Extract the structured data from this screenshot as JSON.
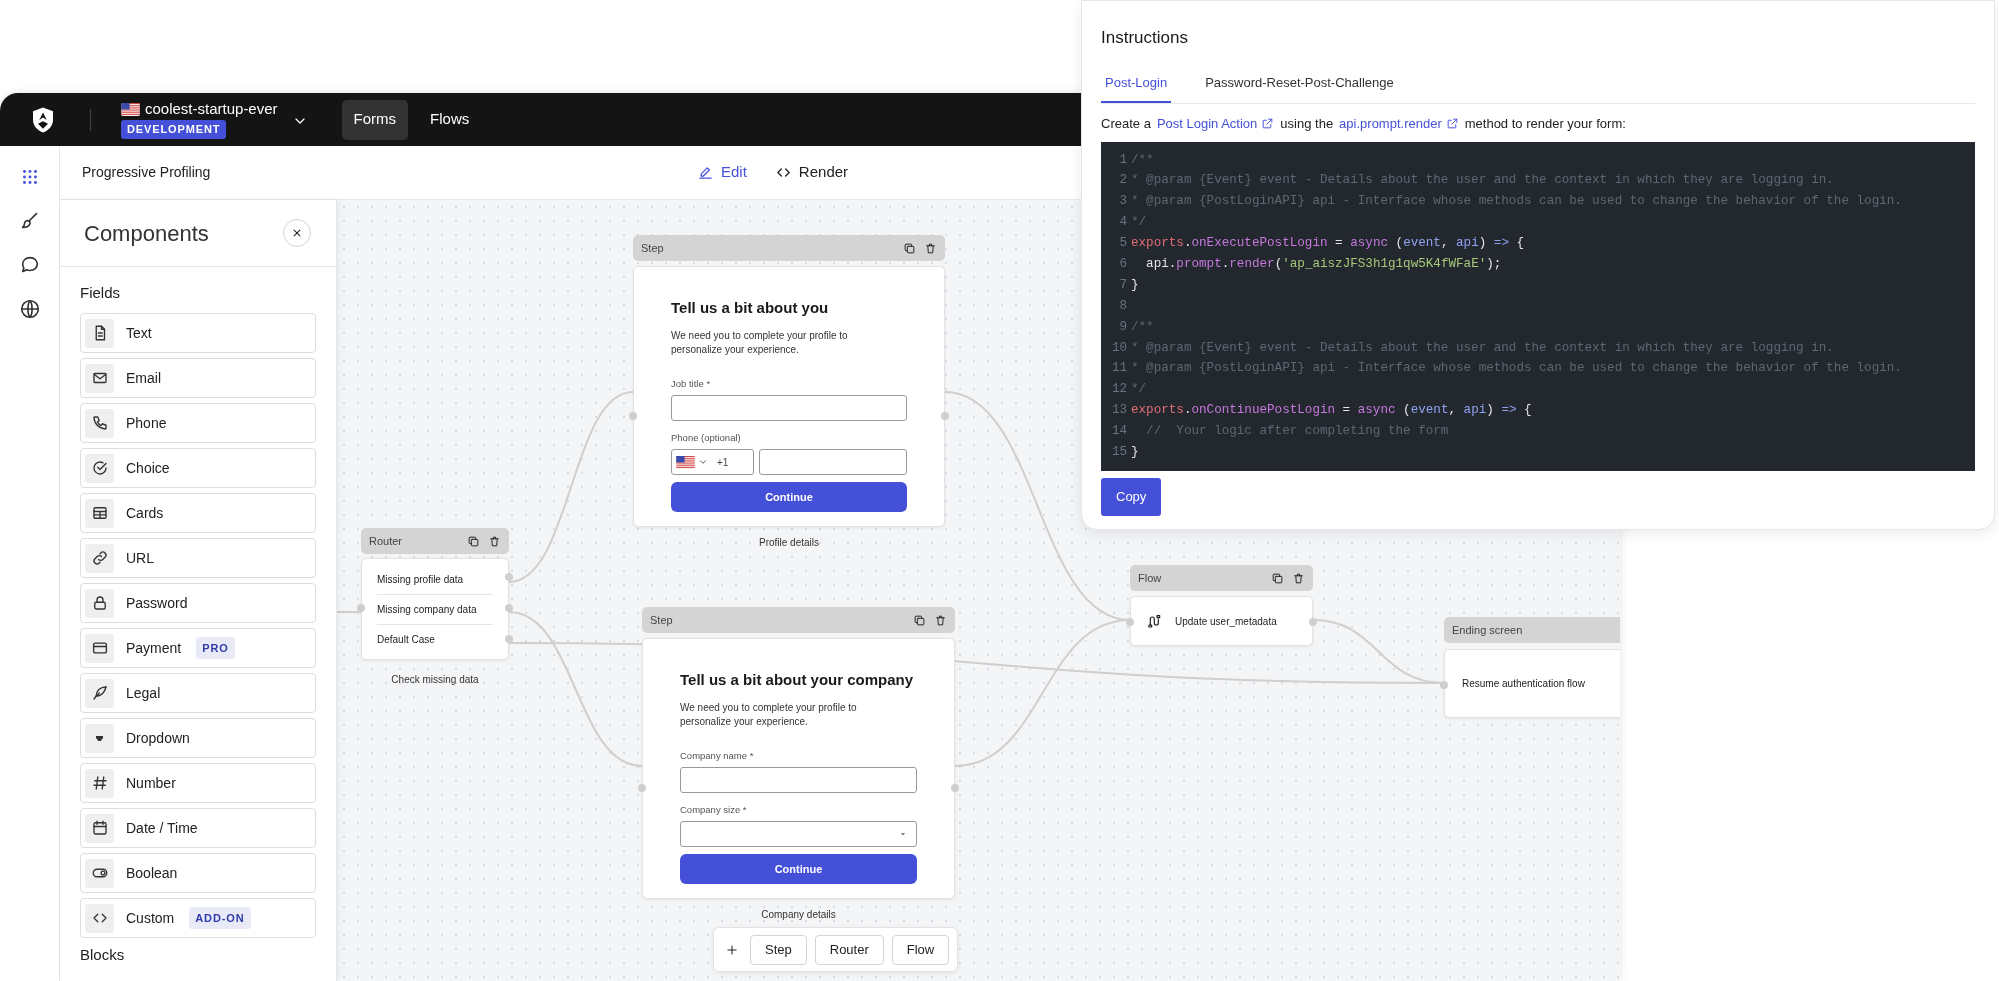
{
  "header": {
    "org": "coolest-startup-ever",
    "environment": "DEVELOPMENT",
    "nav": [
      {
        "label": "Forms",
        "selected": true
      },
      {
        "label": "Flows",
        "selected": false
      }
    ]
  },
  "rail": [
    {
      "kind": "grid",
      "selected": true
    },
    {
      "kind": "brush",
      "selected": false
    },
    {
      "kind": "chat",
      "selected": false
    },
    {
      "kind": "globe",
      "selected": false
    }
  ],
  "toolbar": {
    "title": "Progressive Profiling",
    "modes": [
      {
        "kind": "edit",
        "label": "Edit",
        "selected": true
      },
      {
        "kind": "render",
        "label": "Render",
        "selected": false
      }
    ]
  },
  "components": {
    "title": "Components",
    "sections": [
      {
        "heading": "Fields",
        "items": [
          {
            "kind": "text",
            "label": "Text"
          },
          {
            "kind": "email",
            "label": "Email"
          },
          {
            "kind": "phone",
            "label": "Phone"
          },
          {
            "kind": "choice",
            "label": "Choice"
          },
          {
            "kind": "cards",
            "label": "Cards"
          },
          {
            "kind": "url",
            "label": "URL"
          },
          {
            "kind": "password",
            "label": "Password"
          },
          {
            "kind": "payment",
            "label": "Payment",
            "badge": "PRO"
          },
          {
            "kind": "legal",
            "label": "Legal"
          },
          {
            "kind": "dropdown",
            "label": "Dropdown"
          },
          {
            "kind": "number",
            "label": "Number"
          },
          {
            "kind": "date",
            "label": "Date / Time"
          },
          {
            "kind": "boolean",
            "label": "Boolean"
          },
          {
            "kind": "custom",
            "label": "Custom",
            "badge": "ADD-ON"
          }
        ]
      },
      {
        "heading": "Blocks"
      }
    ]
  },
  "canvas": {
    "nodes": [
      {
        "kind": "step",
        "header": "Step",
        "title": "Tell us a bit about you",
        "description": "We need you to complete your profile to personalize your experience.",
        "fields": [
          {
            "kind": "text",
            "label": "Job title *"
          },
          {
            "kind": "phone",
            "label": "Phone (optional)",
            "code": "+1"
          }
        ],
        "button": "Continue",
        "caption": "Profile details"
      },
      {
        "kind": "router",
        "header": "Router",
        "routes": [
          "Missing profile data",
          "Missing company data",
          "Default Case"
        ],
        "caption": "Check missing data"
      },
      {
        "kind": "step",
        "header": "Step",
        "title": "Tell us a bit about your company",
        "description": "We need you to complete your profile to personalize your experience.",
        "fields": [
          {
            "kind": "text",
            "label": "Company name *"
          },
          {
            "kind": "select",
            "label": "Company size *"
          }
        ],
        "button": "Continue",
        "caption": "Company details"
      },
      {
        "kind": "flow",
        "header": "Flow",
        "action": "Update user_metadata"
      },
      {
        "kind": "ending",
        "header": "Ending screen",
        "text": "Resume authentication flow"
      }
    ],
    "add_buttons": [
      "Step",
      "Router",
      "Flow"
    ]
  },
  "instructions": {
    "title": "Instructions",
    "tabs": [
      {
        "label": "Post-Login",
        "selected": true
      },
      {
        "label": "Password-Reset-Post-Challenge",
        "selected": false
      }
    ],
    "intro": [
      {
        "kind": "text",
        "text": "Create a"
      },
      {
        "kind": "link",
        "text": "Post Login Action"
      },
      {
        "kind": "text",
        "text": "using the"
      },
      {
        "kind": "link",
        "text": "api.prompt.render"
      },
      {
        "kind": "text",
        "text": "method to render your form:"
      }
    ],
    "code": [
      {
        "number": "1",
        "tokens": [
          {
            "kind": "comment",
            "text": "/**"
          }
        ]
      },
      {
        "number": "2",
        "tokens": [
          {
            "kind": "comment",
            "text": "* @param {Event} event - Details about the user and the context in which they are logging in."
          }
        ]
      },
      {
        "number": "3",
        "tokens": [
          {
            "kind": "comment",
            "text": "* @param {PostLoginAPI} api - Interface whose methods can be used to change the behavior of the login."
          }
        ]
      },
      {
        "number": "4",
        "tokens": [
          {
            "kind": "comment",
            "text": "*/"
          }
        ]
      },
      {
        "number": "5",
        "tokens": [
          {
            "kind": "keyword",
            "text": "exports"
          },
          {
            "kind": "plain",
            "text": "."
          },
          {
            "kind": "property",
            "text": "onExecutePostLogin"
          },
          {
            "kind": "plain",
            "text": " = "
          },
          {
            "kind": "property",
            "text": "async"
          },
          {
            "kind": "plain",
            "text": " ("
          },
          {
            "kind": "param",
            "text": "event"
          },
          {
            "kind": "plain",
            "text": ", "
          },
          {
            "kind": "param",
            "text": "api"
          },
          {
            "kind": "plain",
            "text": ") "
          },
          {
            "kind": "param",
            "text": "=>"
          },
          {
            "kind": "plain",
            "text": " {"
          }
        ]
      },
      {
        "number": "6",
        "tokens": [
          {
            "kind": "plain",
            "text": "  api."
          },
          {
            "kind": "property",
            "text": "prompt"
          },
          {
            "kind": "plain",
            "text": "."
          },
          {
            "kind": "property",
            "text": "render"
          },
          {
            "kind": "plain",
            "text": "("
          },
          {
            "kind": "string",
            "text": "'ap_aiszJFS3h1g1qw5K4fWFaE'"
          },
          {
            "kind": "plain",
            "text": ");"
          }
        ]
      },
      {
        "number": "7",
        "tokens": [
          {
            "kind": "plain",
            "text": "}"
          }
        ]
      },
      {
        "number": "8"
      },
      {
        "number": "9",
        "tokens": [
          {
            "kind": "comment",
            "text": "/**"
          }
        ]
      },
      {
        "number": "10",
        "tokens": [
          {
            "kind": "comment",
            "text": "* @param {Event} event - Details about the user and the context in which they are logging in."
          }
        ]
      },
      {
        "number": "11",
        "tokens": [
          {
            "kind": "comment",
            "text": "* @param {PostLoginAPI} api - Interface whose methods can be used to change the behavior of the login."
          }
        ]
      },
      {
        "number": "12",
        "tokens": [
          {
            "kind": "comment",
            "text": "*/"
          }
        ]
      },
      {
        "number": "13",
        "tokens": [
          {
            "kind": "keyword",
            "text": "exports"
          },
          {
            "kind": "plain",
            "text": "."
          },
          {
            "kind": "property",
            "text": "onContinuePostLogin"
          },
          {
            "kind": "plain",
            "text": " = "
          },
          {
            "kind": "property",
            "text": "async"
          },
          {
            "kind": "plain",
            "text": " ("
          },
          {
            "kind": "param",
            "text": "event"
          },
          {
            "kind": "plain",
            "text": ", "
          },
          {
            "kind": "param",
            "text": "api"
          },
          {
            "kind": "plain",
            "text": ") "
          },
          {
            "kind": "param",
            "text": "=>"
          },
          {
            "kind": "plain",
            "text": " {"
          }
        ]
      },
      {
        "number": "14",
        "tokens": [
          {
            "kind": "comment",
            "text": "  //  Your logic after completing the form"
          }
        ]
      },
      {
        "number": "15",
        "tokens": [
          {
            "kind": "plain",
            "text": "}"
          }
        ]
      }
    ],
    "button": "Copy"
  }
}
